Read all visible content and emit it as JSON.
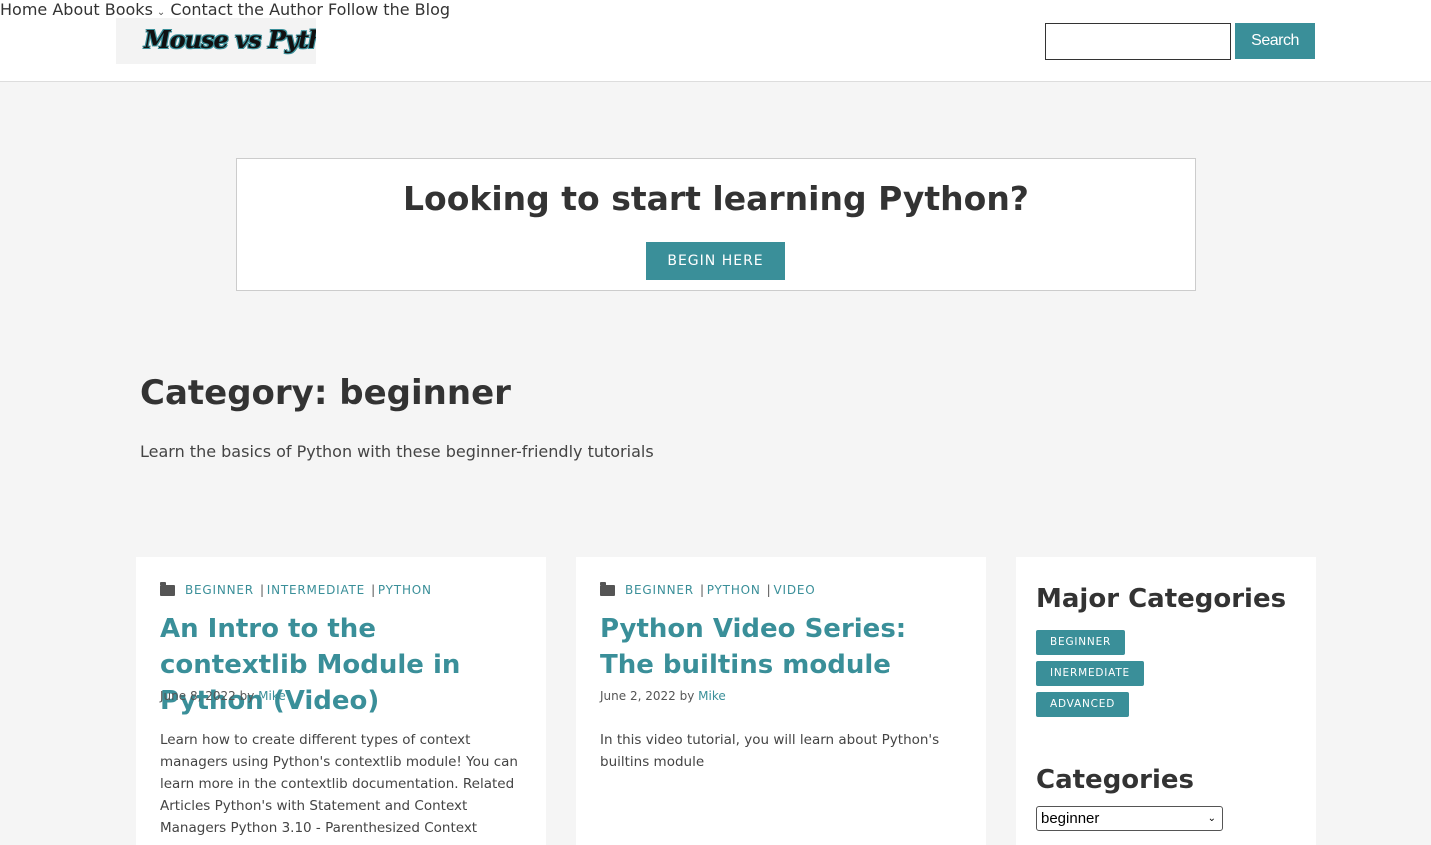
{
  "header": {
    "logo_text": "Mouse vs Python",
    "nav": [
      "Home",
      "About",
      "Books",
      "Contact the Author",
      "Follow the Blog"
    ],
    "search_label": "Search",
    "search_value": ""
  },
  "promo": {
    "title": "Looking to start learning Python?",
    "button": "BEGIN HERE"
  },
  "archive": {
    "title": "Category: beginner",
    "description": "Learn the basics of Python with these beginner-friendly tutorials"
  },
  "posts": [
    {
      "tags": [
        "BEGINNER",
        "INTERMEDIATE",
        "PYTHON"
      ],
      "title": "An Intro to the contextlib Module in Python (Video)",
      "date": "June 8, 2022",
      "by": "by",
      "author": "Mike",
      "excerpt": "Learn how to create different types of context managers using Python's contextlib module! You can learn more in the contextlib documentation. Related Articles Python's with Statement and Context Managers Python 3.10 - Parenthesized Context"
    },
    {
      "tags": [
        "BEGINNER",
        "PYTHON",
        "VIDEO"
      ],
      "title": "Python Video Series: The builtins module",
      "date": "June 2, 2022",
      "by": "by",
      "author": "Mike",
      "excerpt": "In this video tutorial, you will learn about Python's builtins module"
    }
  ],
  "sidebar": {
    "major_title": "Major Categories",
    "major": [
      "BEGINNER",
      "INERMEDIATE",
      "ADVANCED"
    ],
    "categories_title": "Categories",
    "selected_category": "beginner"
  },
  "colors": {
    "accent": "#3a8f99",
    "background": "#f5f5f5"
  }
}
